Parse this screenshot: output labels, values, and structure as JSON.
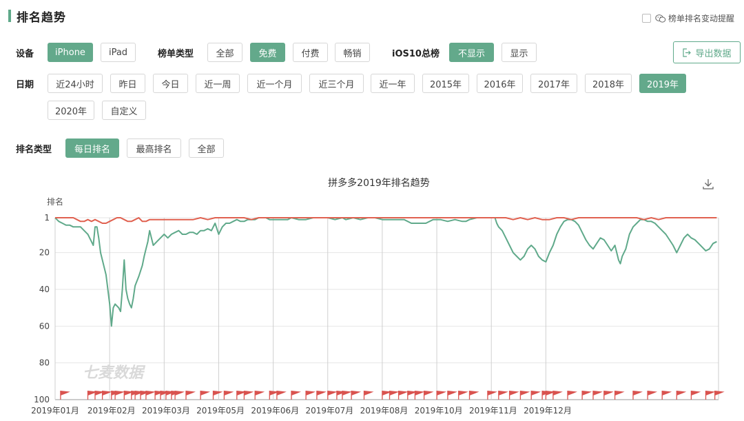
{
  "section_title": "排名趋势",
  "remind_label": "榜单排名变动提醒",
  "filters": {
    "device": {
      "label": "设备",
      "options": [
        "iPhone",
        "iPad"
      ],
      "active": 0
    },
    "list_type": {
      "label": "榜单类型",
      "options": [
        "全部",
        "免费",
        "付费",
        "畅销"
      ],
      "active": 1
    },
    "ios10": {
      "label": "iOS10总榜",
      "options": [
        "不显示",
        "显示"
      ],
      "active": 0
    },
    "date": {
      "label": "日期",
      "options": [
        "近24小时",
        "昨日",
        "今日",
        "近一周",
        "近一个月",
        "近三个月",
        "近一年",
        "2015年",
        "2016年",
        "2017年",
        "2018年",
        "2019年",
        "2020年",
        "自定义"
      ],
      "active": 11
    },
    "rank_type": {
      "label": "排名类型",
      "options": [
        "每日排名",
        "最高排名",
        "全部"
      ],
      "active": 0
    }
  },
  "export_label": "导出数据",
  "watermark": "七麦数据",
  "colors": {
    "accent": "#63a98b",
    "green_series": "#5fa98a",
    "red_series": "#e0604f",
    "flag": "#d9534f"
  },
  "chart_data": {
    "type": "line",
    "title": "拼多多2019年排名趋势",
    "ylabel": "排名",
    "xlabel": "",
    "y_inverted": true,
    "ylim": [
      1,
      100
    ],
    "y_ticks": [
      1,
      20,
      40,
      60,
      80,
      100
    ],
    "xlim": [
      0,
      365
    ],
    "x_ticks": [
      {
        "label": "2019年01月",
        "day": 0
      },
      {
        "label": "2019年02月",
        "day": 31
      },
      {
        "label": "2019年03月",
        "day": 61
      },
      {
        "label": "2019年05月",
        "day": 91
      },
      {
        "label": "2019年06月",
        "day": 121
      },
      {
        "label": "2019年07月",
        "day": 151
      },
      {
        "label": "2019年08月",
        "day": 181
      },
      {
        "label": "2019年10月",
        "day": 211
      },
      {
        "label": "2019年11月",
        "day": 241
      },
      {
        "label": "2019年12月",
        "day": 271
      }
    ],
    "x_tick_days_drawn": [
      0,
      30,
      60,
      90,
      120,
      150,
      180,
      210,
      240,
      270
    ],
    "grid": true,
    "series": [
      {
        "points": [
          [
            0,
            1
          ],
          [
            2,
            3
          ],
          [
            4,
            4
          ],
          [
            6,
            5
          ],
          [
            8,
            5
          ],
          [
            10,
            6
          ],
          [
            12,
            6
          ],
          [
            14,
            6
          ],
          [
            16,
            8
          ],
          [
            18,
            10
          ],
          [
            20,
            14
          ],
          [
            21,
            16
          ],
          [
            22,
            6
          ],
          [
            23,
            6
          ],
          [
            24,
            12
          ],
          [
            25,
            20
          ],
          [
            26,
            24
          ],
          [
            28,
            32
          ],
          [
            30,
            48
          ],
          [
            31,
            60
          ],
          [
            32,
            50
          ],
          [
            33,
            48
          ],
          [
            35,
            50
          ],
          [
            36,
            52
          ],
          [
            37,
            40
          ],
          [
            38,
            24
          ],
          [
            39,
            40
          ],
          [
            40,
            45
          ],
          [
            41,
            48
          ],
          [
            42,
            50
          ],
          [
            43,
            45
          ],
          [
            44,
            38
          ],
          [
            46,
            33
          ],
          [
            47,
            30
          ],
          [
            48,
            27
          ],
          [
            49,
            22
          ],
          [
            50,
            18
          ],
          [
            51,
            14
          ],
          [
            52,
            8
          ],
          [
            53,
            12
          ],
          [
            54,
            16
          ],
          [
            56,
            14
          ],
          [
            58,
            12
          ],
          [
            60,
            10
          ],
          [
            62,
            12
          ],
          [
            64,
            10
          ],
          [
            66,
            9
          ],
          [
            68,
            8
          ],
          [
            70,
            10
          ],
          [
            72,
            10
          ],
          [
            74,
            9
          ],
          [
            76,
            9
          ],
          [
            78,
            10
          ],
          [
            80,
            8
          ],
          [
            82,
            8
          ],
          [
            84,
            7
          ],
          [
            86,
            8
          ],
          [
            88,
            4
          ],
          [
            90,
            10
          ],
          [
            92,
            6
          ],
          [
            94,
            4
          ],
          [
            96,
            4
          ],
          [
            98,
            3
          ],
          [
            100,
            2
          ],
          [
            102,
            3
          ],
          [
            104,
            3
          ],
          [
            106,
            2
          ],
          [
            108,
            2
          ],
          [
            110,
            2
          ],
          [
            112,
            1
          ],
          [
            116,
            1
          ],
          [
            118,
            2
          ],
          [
            120,
            2
          ],
          [
            124,
            2
          ],
          [
            128,
            2
          ],
          [
            130,
            1
          ],
          [
            134,
            2
          ],
          [
            138,
            2
          ],
          [
            142,
            1
          ],
          [
            146,
            1
          ],
          [
            150,
            1
          ],
          [
            154,
            2
          ],
          [
            158,
            1
          ],
          [
            160,
            2
          ],
          [
            164,
            1
          ],
          [
            168,
            2
          ],
          [
            172,
            1
          ],
          [
            176,
            1
          ],
          [
            180,
            2
          ],
          [
            184,
            2
          ],
          [
            188,
            2
          ],
          [
            192,
            2
          ],
          [
            196,
            4
          ],
          [
            200,
            4
          ],
          [
            204,
            4
          ],
          [
            208,
            2
          ],
          [
            212,
            2
          ],
          [
            216,
            3
          ],
          [
            220,
            2
          ],
          [
            224,
            3
          ],
          [
            226,
            3
          ],
          [
            228,
            2
          ],
          [
            232,
            1
          ],
          [
            236,
            1
          ],
          [
            240,
            1
          ],
          [
            242,
            1
          ],
          [
            243,
            4
          ],
          [
            244,
            6
          ],
          [
            246,
            8
          ],
          [
            248,
            12
          ],
          [
            250,
            16
          ],
          [
            252,
            20
          ],
          [
            254,
            22
          ],
          [
            256,
            24
          ],
          [
            258,
            22
          ],
          [
            260,
            18
          ],
          [
            262,
            16
          ],
          [
            264,
            18
          ],
          [
            266,
            22
          ],
          [
            268,
            24
          ],
          [
            270,
            25
          ],
          [
            272,
            20
          ],
          [
            274,
            16
          ],
          [
            276,
            10
          ],
          [
            278,
            6
          ],
          [
            280,
            3
          ],
          [
            282,
            2
          ],
          [
            284,
            2
          ],
          [
            286,
            3
          ],
          [
            288,
            5
          ],
          [
            290,
            9
          ],
          [
            292,
            13
          ],
          [
            294,
            16
          ],
          [
            296,
            18
          ],
          [
            298,
            15
          ],
          [
            300,
            12
          ],
          [
            302,
            13
          ],
          [
            304,
            16
          ],
          [
            306,
            19
          ],
          [
            308,
            16
          ],
          [
            309,
            20
          ],
          [
            310,
            24
          ],
          [
            311,
            26
          ],
          [
            312,
            22
          ],
          [
            314,
            18
          ],
          [
            316,
            10
          ],
          [
            318,
            6
          ],
          [
            320,
            4
          ],
          [
            322,
            2
          ],
          [
            324,
            2
          ],
          [
            326,
            3
          ],
          [
            328,
            3
          ],
          [
            330,
            4
          ],
          [
            332,
            6
          ],
          [
            334,
            8
          ],
          [
            336,
            10
          ],
          [
            338,
            13
          ],
          [
            340,
            16
          ],
          [
            342,
            20
          ],
          [
            344,
            16
          ],
          [
            346,
            12
          ],
          [
            348,
            10
          ],
          [
            350,
            12
          ],
          [
            352,
            13
          ],
          [
            354,
            15
          ],
          [
            356,
            17
          ],
          [
            358,
            19
          ],
          [
            360,
            18
          ],
          [
            362,
            15
          ],
          [
            364,
            14
          ]
        ]
      },
      {
        "points": [
          [
            0,
            1
          ],
          [
            4,
            1
          ],
          [
            8,
            1
          ],
          [
            10,
            1
          ],
          [
            12,
            2
          ],
          [
            14,
            3
          ],
          [
            16,
            3
          ],
          [
            18,
            2
          ],
          [
            20,
            3
          ],
          [
            22,
            2
          ],
          [
            24,
            3
          ],
          [
            26,
            4
          ],
          [
            28,
            4
          ],
          [
            30,
            3
          ],
          [
            32,
            2
          ],
          [
            34,
            1
          ],
          [
            36,
            1
          ],
          [
            38,
            2
          ],
          [
            40,
            3
          ],
          [
            42,
            3
          ],
          [
            44,
            2
          ],
          [
            46,
            1
          ],
          [
            48,
            3
          ],
          [
            50,
            3
          ],
          [
            52,
            2
          ],
          [
            56,
            2
          ],
          [
            60,
            2
          ],
          [
            64,
            2
          ],
          [
            68,
            2
          ],
          [
            72,
            2
          ],
          [
            76,
            2
          ],
          [
            80,
            1
          ],
          [
            84,
            2
          ],
          [
            88,
            1
          ],
          [
            92,
            1
          ],
          [
            96,
            1
          ],
          [
            100,
            1
          ],
          [
            104,
            1
          ],
          [
            108,
            2
          ],
          [
            112,
            1
          ],
          [
            116,
            1
          ],
          [
            120,
            1
          ],
          [
            130,
            1
          ],
          [
            140,
            1
          ],
          [
            150,
            1
          ],
          [
            160,
            1
          ],
          [
            170,
            1
          ],
          [
            180,
            1
          ],
          [
            190,
            1
          ],
          [
            200,
            1
          ],
          [
            210,
            1
          ],
          [
            220,
            1
          ],
          [
            230,
            1
          ],
          [
            240,
            1
          ],
          [
            244,
            1
          ],
          [
            248,
            1
          ],
          [
            252,
            2
          ],
          [
            256,
            1
          ],
          [
            260,
            2
          ],
          [
            264,
            1
          ],
          [
            268,
            2
          ],
          [
            272,
            2
          ],
          [
            276,
            1
          ],
          [
            280,
            1
          ],
          [
            284,
            2
          ],
          [
            288,
            1
          ],
          [
            292,
            1
          ],
          [
            296,
            1
          ],
          [
            300,
            1
          ],
          [
            304,
            1
          ],
          [
            308,
            1
          ],
          [
            312,
            1
          ],
          [
            316,
            1
          ],
          [
            320,
            1
          ],
          [
            324,
            2
          ],
          [
            328,
            1
          ],
          [
            332,
            2
          ],
          [
            336,
            1
          ],
          [
            340,
            1
          ],
          [
            344,
            1
          ],
          [
            348,
            1
          ],
          [
            352,
            1
          ],
          [
            356,
            1
          ],
          [
            360,
            1
          ],
          [
            364,
            1
          ]
        ]
      }
    ],
    "flag_days": [
      3,
      18,
      22,
      26,
      31,
      33,
      38,
      42,
      44,
      47,
      50,
      55,
      58,
      61,
      64,
      66,
      72,
      80,
      87,
      93,
      100,
      104,
      110,
      118,
      122,
      130,
      138,
      144,
      150,
      155,
      158,
      163,
      170,
      180,
      184,
      189,
      194,
      198,
      203,
      210,
      216,
      222,
      228,
      238,
      244,
      250,
      256,
      262,
      268,
      270,
      274,
      282,
      290,
      296,
      302,
      308,
      318,
      326,
      334,
      342,
      350,
      358,
      363
    ]
  }
}
